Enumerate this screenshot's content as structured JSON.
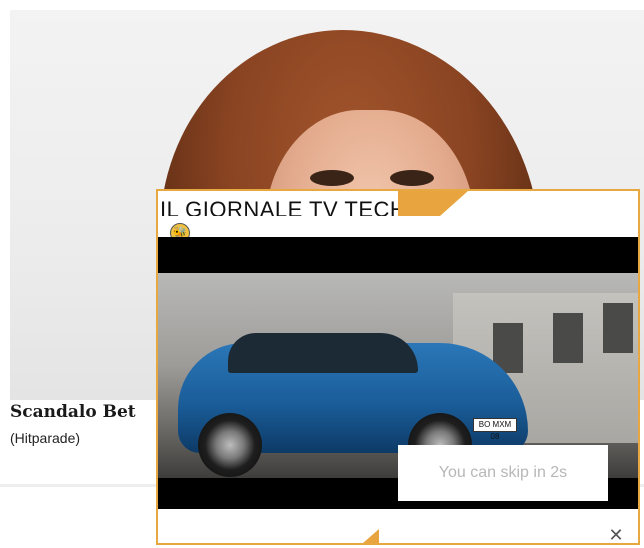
{
  "article": {
    "title": "Scandalo Bet",
    "source": "(Hitparade)"
  },
  "ad": {
    "brand": "IL GIORNALE TV TECH",
    "accent_color": "#e8a53f",
    "video": {
      "skip_text": "You can skip in 2s",
      "plate_text": "BO MXM 08"
    },
    "footer": {
      "text": "",
      "close_icon": "close-icon"
    },
    "badge_icon": "bee-icon"
  }
}
